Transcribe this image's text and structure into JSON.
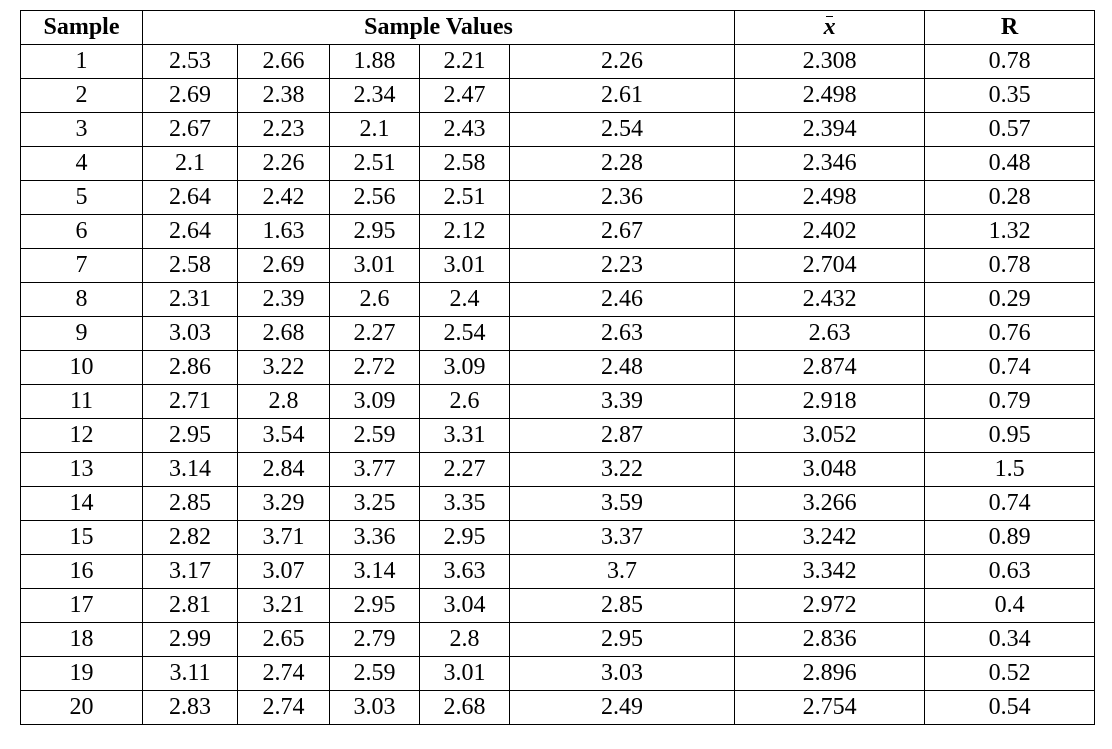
{
  "headers": {
    "sample": "Sample",
    "values": "Sample Values",
    "xbar": "x",
    "r": "R"
  },
  "rows": [
    {
      "sample": "1",
      "v1": "2.53",
      "v2": "2.66",
      "v3": "1.88",
      "v4": "2.21",
      "v5": "2.26",
      "xbar": "2.308",
      "r": "0.78"
    },
    {
      "sample": "2",
      "v1": "2.69",
      "v2": "2.38",
      "v3": "2.34",
      "v4": "2.47",
      "v5": "2.61",
      "xbar": "2.498",
      "r": "0.35"
    },
    {
      "sample": "3",
      "v1": "2.67",
      "v2": "2.23",
      "v3": "2.1",
      "v4": "2.43",
      "v5": "2.54",
      "xbar": "2.394",
      "r": "0.57"
    },
    {
      "sample": "4",
      "v1": "2.1",
      "v2": "2.26",
      "v3": "2.51",
      "v4": "2.58",
      "v5": "2.28",
      "xbar": "2.346",
      "r": "0.48"
    },
    {
      "sample": "5",
      "v1": "2.64",
      "v2": "2.42",
      "v3": "2.56",
      "v4": "2.51",
      "v5": "2.36",
      "xbar": "2.498",
      "r": "0.28"
    },
    {
      "sample": "6",
      "v1": "2.64",
      "v2": "1.63",
      "v3": "2.95",
      "v4": "2.12",
      "v5": "2.67",
      "xbar": "2.402",
      "r": "1.32"
    },
    {
      "sample": "7",
      "v1": "2.58",
      "v2": "2.69",
      "v3": "3.01",
      "v4": "3.01",
      "v5": "2.23",
      "xbar": "2.704",
      "r": "0.78"
    },
    {
      "sample": "8",
      "v1": "2.31",
      "v2": "2.39",
      "v3": "2.6",
      "v4": "2.4",
      "v5": "2.46",
      "xbar": "2.432",
      "r": "0.29"
    },
    {
      "sample": "9",
      "v1": "3.03",
      "v2": "2.68",
      "v3": "2.27",
      "v4": "2.54",
      "v5": "2.63",
      "xbar": "2.63",
      "r": "0.76"
    },
    {
      "sample": "10",
      "v1": "2.86",
      "v2": "3.22",
      "v3": "2.72",
      "v4": "3.09",
      "v5": "2.48",
      "xbar": "2.874",
      "r": "0.74"
    },
    {
      "sample": "11",
      "v1": "2.71",
      "v2": "2.8",
      "v3": "3.09",
      "v4": "2.6",
      "v5": "3.39",
      "xbar": "2.918",
      "r": "0.79"
    },
    {
      "sample": "12",
      "v1": "2.95",
      "v2": "3.54",
      "v3": "2.59",
      "v4": "3.31",
      "v5": "2.87",
      "xbar": "3.052",
      "r": "0.95"
    },
    {
      "sample": "13",
      "v1": "3.14",
      "v2": "2.84",
      "v3": "3.77",
      "v4": "2.27",
      "v5": "3.22",
      "xbar": "3.048",
      "r": "1.5"
    },
    {
      "sample": "14",
      "v1": "2.85",
      "v2": "3.29",
      "v3": "3.25",
      "v4": "3.35",
      "v5": "3.59",
      "xbar": "3.266",
      "r": "0.74"
    },
    {
      "sample": "15",
      "v1": "2.82",
      "v2": "3.71",
      "v3": "3.36",
      "v4": "2.95",
      "v5": "3.37",
      "xbar": "3.242",
      "r": "0.89"
    },
    {
      "sample": "16",
      "v1": "3.17",
      "v2": "3.07",
      "v3": "3.14",
      "v4": "3.63",
      "v5": "3.7",
      "xbar": "3.342",
      "r": "0.63"
    },
    {
      "sample": "17",
      "v1": "2.81",
      "v2": "3.21",
      "v3": "2.95",
      "v4": "3.04",
      "v5": "2.85",
      "xbar": "2.972",
      "r": "0.4"
    },
    {
      "sample": "18",
      "v1": "2.99",
      "v2": "2.65",
      "v3": "2.79",
      "v4": "2.8",
      "v5": "2.95",
      "xbar": "2.836",
      "r": "0.34"
    },
    {
      "sample": "19",
      "v1": "3.11",
      "v2": "2.74",
      "v3": "2.59",
      "v4": "3.01",
      "v5": "3.03",
      "xbar": "2.896",
      "r": "0.52"
    },
    {
      "sample": "20",
      "v1": "2.83",
      "v2": "2.74",
      "v3": "3.03",
      "v4": "2.68",
      "v5": "2.49",
      "xbar": "2.754",
      "r": "0.54"
    }
  ]
}
